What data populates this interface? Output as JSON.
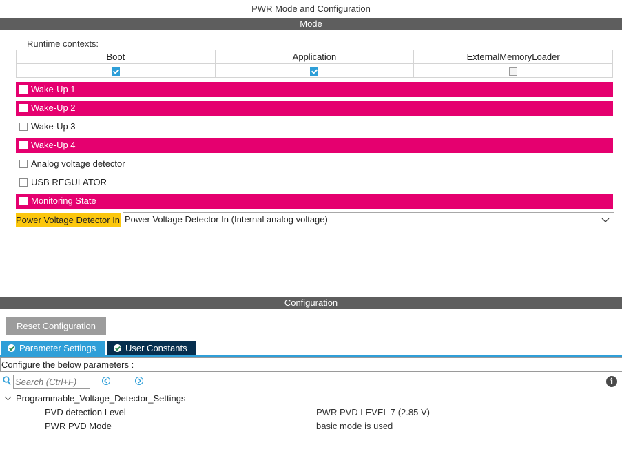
{
  "window": {
    "title": "PWR Mode and Configuration"
  },
  "mode": {
    "header": "Mode",
    "runtime_label": "Runtime contexts:",
    "contexts": [
      {
        "label": "Boot",
        "checked": true
      },
      {
        "label": "Application",
        "checked": true
      },
      {
        "label": "ExternalMemoryLoader",
        "checked": false
      }
    ],
    "rows": [
      {
        "label": "Wake-Up 1",
        "highlighted": true
      },
      {
        "label": "Wake-Up 2",
        "highlighted": true
      },
      {
        "label": "Wake-Up 3",
        "highlighted": false
      },
      {
        "label": "Wake-Up 4",
        "highlighted": true
      },
      {
        "label": "Analog voltage detector",
        "highlighted": false
      },
      {
        "label": "USB REGULATOR",
        "highlighted": false
      },
      {
        "label": "Monitoring State",
        "highlighted": true
      }
    ],
    "pvd": {
      "label": "Power Voltage Detector In",
      "value": "Power Voltage Detector In (Internal analog voltage)"
    }
  },
  "configuration": {
    "header": "Configuration",
    "reset_label": "Reset Configuration",
    "tabs": [
      {
        "label": "Parameter Settings",
        "active": true
      },
      {
        "label": "User Constants",
        "active": false
      }
    ],
    "configure_text": "Configure the below parameters :",
    "search_placeholder": "Search (Ctrl+F)",
    "group": {
      "label": "Programmable_Voltage_Detector_Settings",
      "params": [
        {
          "name": "PVD detection Level",
          "value": "PWR PVD LEVEL 7 (2.85 V)"
        },
        {
          "name": "PWR PVD Mode",
          "value": "basic mode is used"
        }
      ]
    }
  },
  "colors": {
    "highlight_pink": "#e5006f",
    "pvd_yellow": "#fcc70d",
    "accent_blue": "#2f9fd8",
    "tab_dark": "#062f4f",
    "header_grey": "#5e5e5e"
  },
  "icons": {
    "search": "search-icon",
    "prev": "chevron-left-circle-icon",
    "next": "chevron-right-circle-icon",
    "info": "info-icon",
    "tab_status": "check-circle-icon"
  }
}
